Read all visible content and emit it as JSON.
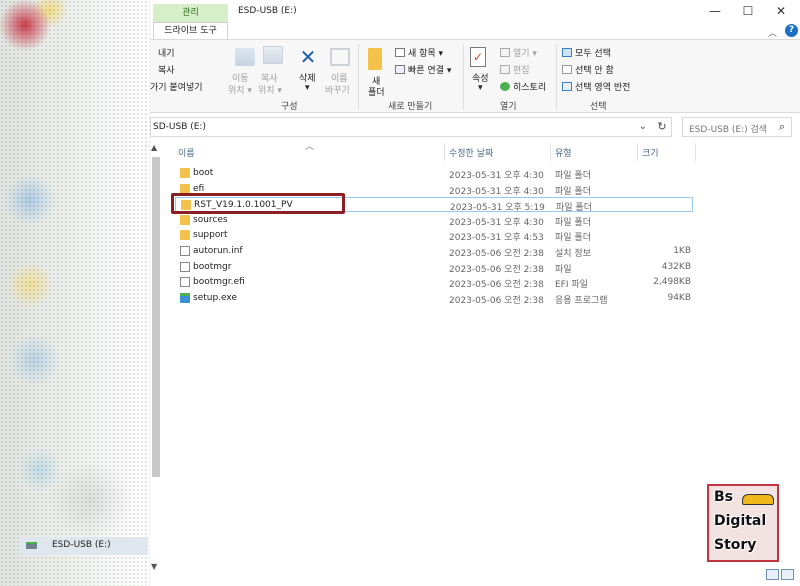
{
  "window": {
    "title": "ESD-USB (E:)",
    "minimize": "—",
    "maximize": "☐",
    "close": "✕",
    "help": "?"
  },
  "ribbon_tabs": {
    "manage": "관리",
    "drive_tools": "드라이브 도구"
  },
  "ribbon": {
    "clipboard_partial": [
      "내기",
      "복사",
      "가기 붙여넣기"
    ],
    "move_to": [
      "이동",
      "위치 ▾"
    ],
    "copy_to": [
      "복사",
      "위치 ▾"
    ],
    "delete": [
      "삭제",
      "▾"
    ],
    "rename": [
      "이름",
      "바꾸기"
    ],
    "new_folder": [
      "새",
      "폴더"
    ],
    "new_item": "새 항목 ▾",
    "easy_access": "빠른 연결 ▾",
    "properties": [
      "속성",
      "▾"
    ],
    "open": "열기 ▾",
    "edit": "편집",
    "history": "히스토리",
    "select_all": "모두 선택",
    "select_none": "선택 안 함",
    "invert_selection": "선택 영역 반전",
    "groups": {
      "organize": "구성",
      "new": "새로 만들기",
      "open": "열기",
      "select": "선택"
    }
  },
  "address": {
    "path": "SD-USB (E:)",
    "dropdown": "⌄",
    "refresh": "↻",
    "search_placeholder": "ESD-USB (E:) 검색",
    "search_icon": "⌕"
  },
  "columns": {
    "name": "이름",
    "modified": "수정한 날짜",
    "type": "유형",
    "size": "크기"
  },
  "files": [
    {
      "name": "boot",
      "modified": "2023-05-31 오후 4:30",
      "type": "파일 폴더",
      "size": "",
      "kind": "folder"
    },
    {
      "name": "efi",
      "modified": "2023-05-31 오후 4:30",
      "type": "파일 폴더",
      "size": "",
      "kind": "folder"
    },
    {
      "name": "RST_V19.1.0.1001_PV",
      "modified": "2023-05-31 오후 5:19",
      "type": "파일 폴더",
      "size": "",
      "kind": "folder",
      "selected": true
    },
    {
      "name": "sources",
      "modified": "2023-05-31 오후 4:30",
      "type": "파일 폴더",
      "size": "",
      "kind": "folder"
    },
    {
      "name": "support",
      "modified": "2023-05-31 오후 4:53",
      "type": "파일 폴더",
      "size": "",
      "kind": "folder"
    },
    {
      "name": "autorun.inf",
      "modified": "2023-05-06 오전 2:38",
      "type": "설치 정보",
      "size": "1KB",
      "kind": "file"
    },
    {
      "name": "bootmgr",
      "modified": "2023-05-06 오전 2:38",
      "type": "파일",
      "size": "432KB",
      "kind": "file"
    },
    {
      "name": "bootmgr.efi",
      "modified": "2023-05-06 오전 2:38",
      "type": "EFI 파일",
      "size": "2,498KB",
      "kind": "file"
    },
    {
      "name": "setup.exe",
      "modified": "2023-05-06 오전 2:38",
      "type": "응용 프로그램",
      "size": "94KB",
      "kind": "exe"
    }
  ],
  "nav_pane": {
    "usb_drive": "ESD-USB (E:)"
  },
  "logo": {
    "line1": "Bs",
    "line2": "Digital",
    "line3": "Story"
  },
  "colors": {
    "manage_tab": "#d6efc8",
    "highlight_box": "#8c1f24",
    "selection": "#99c9ef"
  }
}
